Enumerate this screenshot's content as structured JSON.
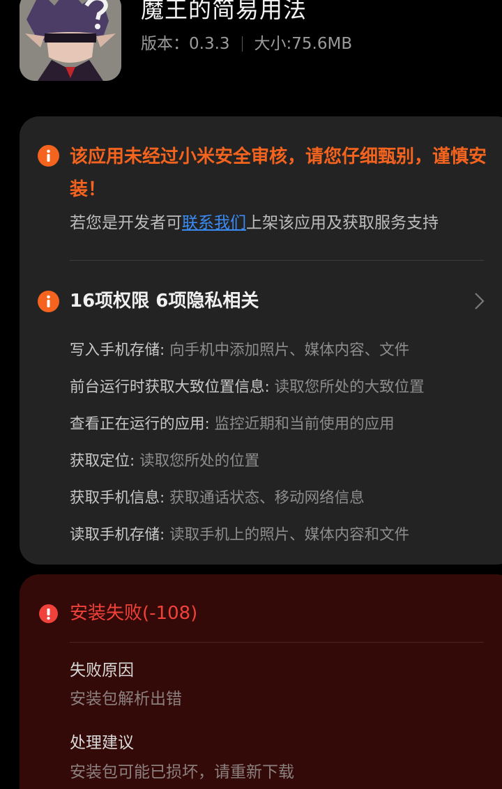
{
  "app": {
    "title": "魔王的简易用法",
    "version_label": "版本：",
    "version": "0.3.3",
    "size_label": "大小:",
    "size": "75.6MB"
  },
  "security": {
    "warning": "该应用未经过小米安全审核，请您仔细甄别，谨慎安装！",
    "dev_prefix": "若您是开发者可",
    "dev_link": "联系我们",
    "dev_suffix": "上架该应用及获取服务支持"
  },
  "permissions": {
    "summary": "16项权限 6项隐私相关",
    "items": [
      {
        "name": "写入手机存储:",
        "desc": "向手机中添加照片、媒体内容、文件"
      },
      {
        "name": "前台运行时获取大致位置信息:",
        "desc": "读取您所处的大致位置"
      },
      {
        "name": "查看正在运行的应用:",
        "desc": "监控近期和当前使用的应用"
      },
      {
        "name": "获取定位:",
        "desc": "读取您所处的位置"
      },
      {
        "name": "获取手机信息:",
        "desc": "获取通话状态、移动网络信息"
      },
      {
        "name": "读取手机存储:",
        "desc": "读取手机上的照片、媒体内容和文件"
      }
    ]
  },
  "failure": {
    "title": "安装失败(-108)",
    "reason_label": "失败原因",
    "reason": "安装包解析出错",
    "suggestion_label": "处理建议",
    "suggestion": "安装包可能已损坏，请重新下载"
  },
  "colors": {
    "warning": "#f5641e",
    "error": "#f0413a",
    "link": "#3b8bf5",
    "card_bg": "#232323",
    "fail_bg": "#330a07"
  }
}
